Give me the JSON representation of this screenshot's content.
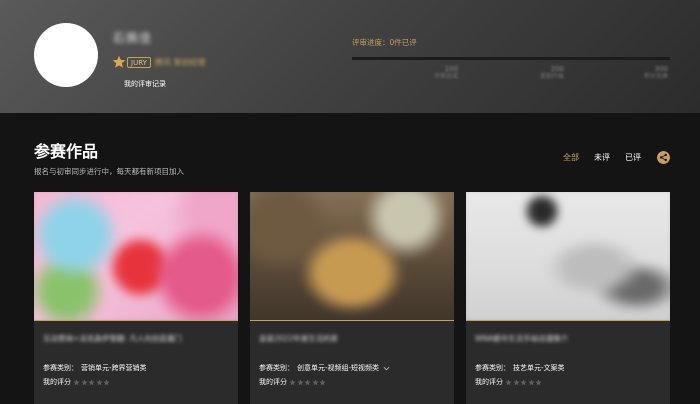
{
  "header": {
    "user_name": "石佩佳",
    "jury_badge": "JURY",
    "jury_org": "腾讯 策划经理",
    "review_record": "我的评审记录",
    "progress_label": "评审进度：0件已评",
    "progress_fraction": 0.0,
    "ticks": [
      {
        "num": "100",
        "label": "评审达成"
      },
      {
        "num": "200",
        "label": "奖励升级"
      },
      {
        "num": "300",
        "label": "积分兑换"
      }
    ]
  },
  "section": {
    "title": "参赛作品",
    "subtitle": "报名与初审同步进行中，每天都有新项目加入"
  },
  "filters": {
    "tabs": [
      {
        "label": "全部",
        "active": true
      },
      {
        "label": "未评",
        "active": false
      },
      {
        "label": "已评",
        "active": false
      }
    ]
  },
  "cards": [
    {
      "title": "互动营销+派克森伊雪翻: 凡人向创造漏门",
      "category_label": "参赛类别：",
      "category_value": "营销单元-跨界营销类",
      "rating_label": "我的评分",
      "rating": 0,
      "stars_max": 5
    },
    {
      "title": "盒装2022年度生活的家",
      "category_label": "参赛类别：",
      "category_value": "创意单元-视频组-短视频类",
      "rating_label": "我的评分",
      "rating": 0,
      "stars_max": 5
    },
    {
      "title": "WNA都市生活手绘动漫推介",
      "category_label": "参赛类别：",
      "category_value": "技艺单元-文案类",
      "rating_label": "我的评分",
      "rating": 0,
      "stars_max": 5
    }
  ],
  "colors": {
    "accent": "#c9a25a",
    "background": "#141414",
    "card": "#2b2b2b"
  }
}
